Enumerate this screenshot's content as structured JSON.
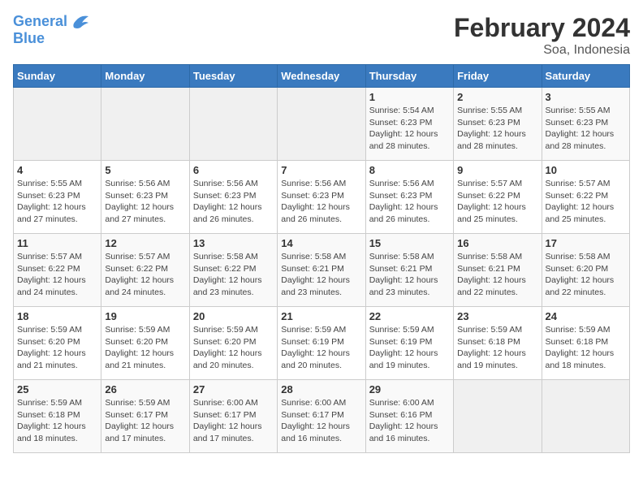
{
  "logo": {
    "line1": "General",
    "line2": "Blue"
  },
  "title": "February 2024",
  "subtitle": "Soa, Indonesia",
  "header_days": [
    "Sunday",
    "Monday",
    "Tuesday",
    "Wednesday",
    "Thursday",
    "Friday",
    "Saturday"
  ],
  "weeks": [
    [
      {
        "num": "",
        "info": ""
      },
      {
        "num": "",
        "info": ""
      },
      {
        "num": "",
        "info": ""
      },
      {
        "num": "",
        "info": ""
      },
      {
        "num": "1",
        "info": "Sunrise: 5:54 AM\nSunset: 6:23 PM\nDaylight: 12 hours\nand 28 minutes."
      },
      {
        "num": "2",
        "info": "Sunrise: 5:55 AM\nSunset: 6:23 PM\nDaylight: 12 hours\nand 28 minutes."
      },
      {
        "num": "3",
        "info": "Sunrise: 5:55 AM\nSunset: 6:23 PM\nDaylight: 12 hours\nand 28 minutes."
      }
    ],
    [
      {
        "num": "4",
        "info": "Sunrise: 5:55 AM\nSunset: 6:23 PM\nDaylight: 12 hours\nand 27 minutes."
      },
      {
        "num": "5",
        "info": "Sunrise: 5:56 AM\nSunset: 6:23 PM\nDaylight: 12 hours\nand 27 minutes."
      },
      {
        "num": "6",
        "info": "Sunrise: 5:56 AM\nSunset: 6:23 PM\nDaylight: 12 hours\nand 26 minutes."
      },
      {
        "num": "7",
        "info": "Sunrise: 5:56 AM\nSunset: 6:23 PM\nDaylight: 12 hours\nand 26 minutes."
      },
      {
        "num": "8",
        "info": "Sunrise: 5:56 AM\nSunset: 6:23 PM\nDaylight: 12 hours\nand 26 minutes."
      },
      {
        "num": "9",
        "info": "Sunrise: 5:57 AM\nSunset: 6:22 PM\nDaylight: 12 hours\nand 25 minutes."
      },
      {
        "num": "10",
        "info": "Sunrise: 5:57 AM\nSunset: 6:22 PM\nDaylight: 12 hours\nand 25 minutes."
      }
    ],
    [
      {
        "num": "11",
        "info": "Sunrise: 5:57 AM\nSunset: 6:22 PM\nDaylight: 12 hours\nand 24 minutes."
      },
      {
        "num": "12",
        "info": "Sunrise: 5:57 AM\nSunset: 6:22 PM\nDaylight: 12 hours\nand 24 minutes."
      },
      {
        "num": "13",
        "info": "Sunrise: 5:58 AM\nSunset: 6:22 PM\nDaylight: 12 hours\nand 23 minutes."
      },
      {
        "num": "14",
        "info": "Sunrise: 5:58 AM\nSunset: 6:21 PM\nDaylight: 12 hours\nand 23 minutes."
      },
      {
        "num": "15",
        "info": "Sunrise: 5:58 AM\nSunset: 6:21 PM\nDaylight: 12 hours\nand 23 minutes."
      },
      {
        "num": "16",
        "info": "Sunrise: 5:58 AM\nSunset: 6:21 PM\nDaylight: 12 hours\nand 22 minutes."
      },
      {
        "num": "17",
        "info": "Sunrise: 5:58 AM\nSunset: 6:20 PM\nDaylight: 12 hours\nand 22 minutes."
      }
    ],
    [
      {
        "num": "18",
        "info": "Sunrise: 5:59 AM\nSunset: 6:20 PM\nDaylight: 12 hours\nand 21 minutes."
      },
      {
        "num": "19",
        "info": "Sunrise: 5:59 AM\nSunset: 6:20 PM\nDaylight: 12 hours\nand 21 minutes."
      },
      {
        "num": "20",
        "info": "Sunrise: 5:59 AM\nSunset: 6:20 PM\nDaylight: 12 hours\nand 20 minutes."
      },
      {
        "num": "21",
        "info": "Sunrise: 5:59 AM\nSunset: 6:19 PM\nDaylight: 12 hours\nand 20 minutes."
      },
      {
        "num": "22",
        "info": "Sunrise: 5:59 AM\nSunset: 6:19 PM\nDaylight: 12 hours\nand 19 minutes."
      },
      {
        "num": "23",
        "info": "Sunrise: 5:59 AM\nSunset: 6:18 PM\nDaylight: 12 hours\nand 19 minutes."
      },
      {
        "num": "24",
        "info": "Sunrise: 5:59 AM\nSunset: 6:18 PM\nDaylight: 12 hours\nand 18 minutes."
      }
    ],
    [
      {
        "num": "25",
        "info": "Sunrise: 5:59 AM\nSunset: 6:18 PM\nDaylight: 12 hours\nand 18 minutes."
      },
      {
        "num": "26",
        "info": "Sunrise: 5:59 AM\nSunset: 6:17 PM\nDaylight: 12 hours\nand 17 minutes."
      },
      {
        "num": "27",
        "info": "Sunrise: 6:00 AM\nSunset: 6:17 PM\nDaylight: 12 hours\nand 17 minutes."
      },
      {
        "num": "28",
        "info": "Sunrise: 6:00 AM\nSunset: 6:17 PM\nDaylight: 12 hours\nand 16 minutes."
      },
      {
        "num": "29",
        "info": "Sunrise: 6:00 AM\nSunset: 6:16 PM\nDaylight: 12 hours\nand 16 minutes."
      },
      {
        "num": "",
        "info": ""
      },
      {
        "num": "",
        "info": ""
      }
    ]
  ]
}
